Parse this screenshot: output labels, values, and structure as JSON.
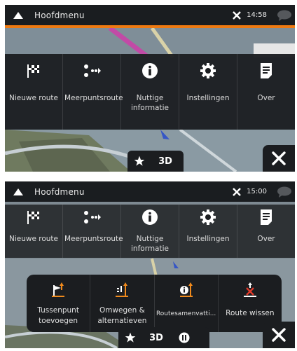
{
  "colors": {
    "accent": "#ee7a12",
    "icon_orange": "#f08a1c",
    "icon_red": "#e03a2a",
    "bar": "#1b1d20"
  },
  "screen1": {
    "status": {
      "title": "Hoofdmenu",
      "time": "14:58"
    },
    "menu": [
      {
        "label": "Nieuwe route",
        "icon": "checkered-flag-icon"
      },
      {
        "label": "Meerpuntsroute",
        "icon": "multipoint-route-icon"
      },
      {
        "label": "Nuttige informatie",
        "icon": "info-icon"
      },
      {
        "label": "Instellingen",
        "icon": "gear-icon"
      },
      {
        "label": "Over",
        "icon": "document-icon"
      }
    ],
    "bottom": {
      "view": "3D"
    }
  },
  "screen2": {
    "status": {
      "title": "Hoofdmenu",
      "time": "15:00"
    },
    "menu": [
      {
        "label": "Nieuwe route",
        "icon": "checkered-flag-icon"
      },
      {
        "label": "Meerpuntsroute",
        "icon": "multipoint-route-icon"
      },
      {
        "label": "Nuttige informatie",
        "icon": "info-icon"
      },
      {
        "label": "Instellingen",
        "icon": "gear-icon"
      },
      {
        "label": "Over",
        "icon": "document-icon"
      }
    ],
    "submenu": [
      {
        "label": "Tussenpunt toevoegen",
        "icon": "add-waypoint-icon"
      },
      {
        "label": "Omwegen & alternatieven",
        "icon": "detours-icon"
      },
      {
        "label": "Routesamenvatti...",
        "icon": "route-summary-icon"
      },
      {
        "label": "Route wissen",
        "icon": "delete-route-icon"
      }
    ],
    "bottom": {
      "view": "3D"
    }
  }
}
